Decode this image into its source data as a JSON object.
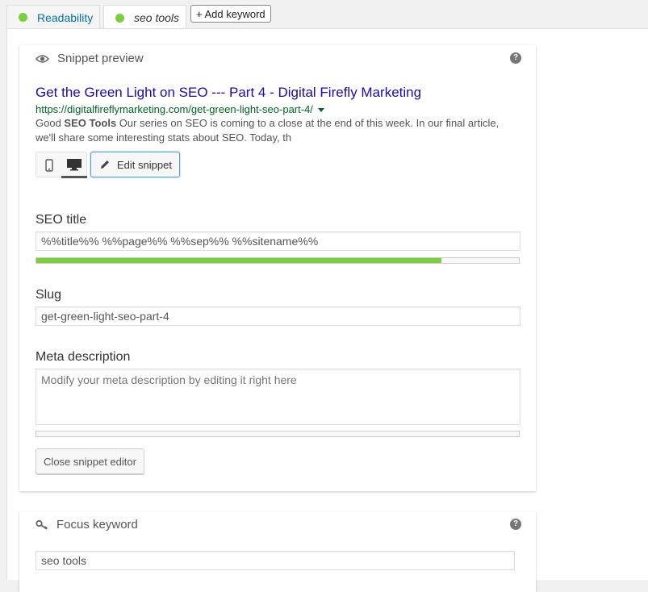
{
  "tabs": [
    {
      "label": "Readability",
      "active": false
    },
    {
      "label": "seo tools",
      "active": true
    }
  ],
  "add_keyword_label": "+ Add keyword",
  "snippet": {
    "heading": "Snippet preview",
    "title": "Get the Green Light on SEO --- Part 4 - Digital Firefly Marketing",
    "url": "https://digitalfireflymarketing.com/get-green-light-seo-part-4/",
    "desc_start": "Good ",
    "desc_bold": "SEO Tools",
    "desc_rest": " Our series on SEO is coming to a close at the end of this week. In our final article, we'll share some interesting stats about SEO. Today, th",
    "edit_label": "Edit snippet",
    "mode_selected": "desktop"
  },
  "seo_title": {
    "label": "SEO title",
    "value": "%%title%% %%page%% %%sep%% %%sitename%%",
    "progress": 0.84
  },
  "slug": {
    "label": "Slug",
    "value": "get-green-light-seo-part-4"
  },
  "meta": {
    "label": "Meta description",
    "placeholder": "Modify your meta description by editing it right here",
    "progress": 0
  },
  "close_label": "Close snippet editor",
  "focus": {
    "heading": "Focus keyword",
    "value": "seo tools"
  },
  "colors": {
    "status_good": "#7ad03a",
    "link": "#1a0dab",
    "url": "#006621"
  }
}
